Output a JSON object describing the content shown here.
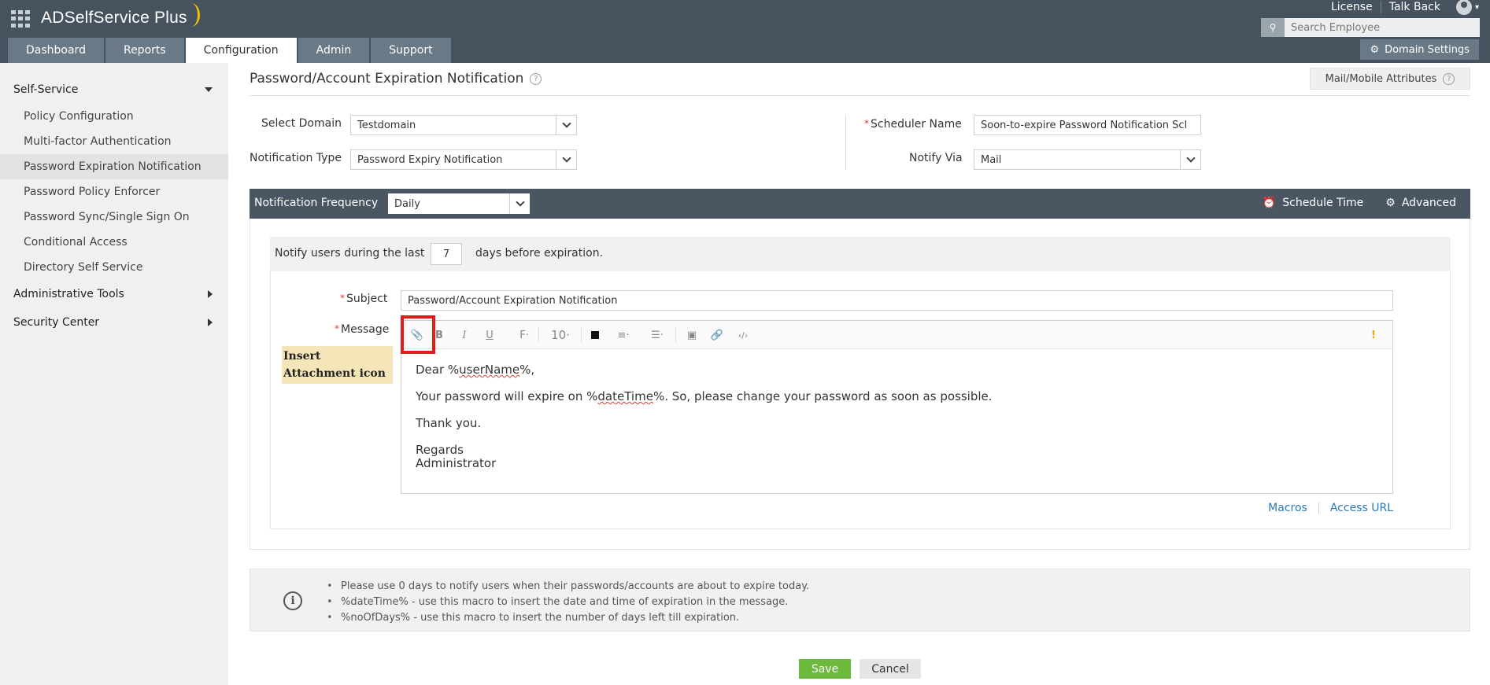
{
  "app": {
    "name": "ADSelfService Plus",
    "top_links": [
      "License",
      "Talk Back"
    ]
  },
  "search": {
    "placeholder": "Search Employee"
  },
  "nav": {
    "tabs": [
      "Dashboard",
      "Reports",
      "Configuration",
      "Admin",
      "Support"
    ],
    "active": "Configuration",
    "domain_settings": "Domain Settings"
  },
  "sidebar": {
    "sections": [
      {
        "label": "Self-Service",
        "expanded": true,
        "items": [
          "Policy Configuration",
          "Multi-factor Authentication",
          "Password Expiration Notification",
          "Password Policy Enforcer",
          "Password Sync/Single Sign On",
          "Conditional Access",
          "Directory Self Service"
        ],
        "active_item": "Password Expiration Notification"
      },
      {
        "label": "Administrative Tools",
        "expanded": false
      },
      {
        "label": "Security Center",
        "expanded": false
      }
    ]
  },
  "page": {
    "title": "Password/Account Expiration Notification",
    "mail_attributes_button": "Mail/Mobile Attributes"
  },
  "form": {
    "select_domain_label": "Select Domain",
    "select_domain_value": "Testdomain",
    "notification_type_label": "Notification Type",
    "notification_type_value": "Password Expiry Notification",
    "scheduler_name_label": "Scheduler Name",
    "scheduler_name_value": "Soon-to-expire Password Notification Scl",
    "notify_via_label": "Notify Via",
    "notify_via_value": "Mail"
  },
  "frequency": {
    "label": "Notification Frequency",
    "value": "Daily",
    "schedule_time": "Schedule Time",
    "advanced": "Advanced"
  },
  "notify": {
    "prefix": "Notify users during the last",
    "days": "7",
    "suffix": "days before expiration."
  },
  "subject": {
    "label": "Subject",
    "value": "Password/Account Expiration Notification"
  },
  "message": {
    "label": "Message",
    "font_size": "10",
    "body": {
      "greeting_prefix": "Dear %",
      "greeting_macro": "userName",
      "greeting_suffix": "%,",
      "line2_prefix": "Your password will expire on %",
      "line2_macro": "dateTime",
      "line2_suffix": "%. So, please change your password as soon as possible.",
      "line3": "Thank you.",
      "line4": "Regards",
      "line5": "Administrator"
    },
    "macros_link": "Macros",
    "access_url_link": "Access URL"
  },
  "callout": {
    "text": "Insert Attachment icon"
  },
  "info": {
    "items": [
      "Please use 0 days to notify users when their passwords/accounts are about to expire today.",
      "%dateTime% - use this macro to insert the date and time of expiration in the message.",
      "%noOfDays% - use this macro to insert the number of days left till expiration."
    ]
  },
  "buttons": {
    "save": "Save",
    "cancel": "Cancel"
  },
  "colors": {
    "header_bg": "#46535f",
    "tab_bg": "#6a7986",
    "highlight_red": "#e21b1b",
    "save_green": "#6cb93d",
    "link_blue": "#2a7ab8",
    "callout_bg": "#f4e6b8"
  }
}
